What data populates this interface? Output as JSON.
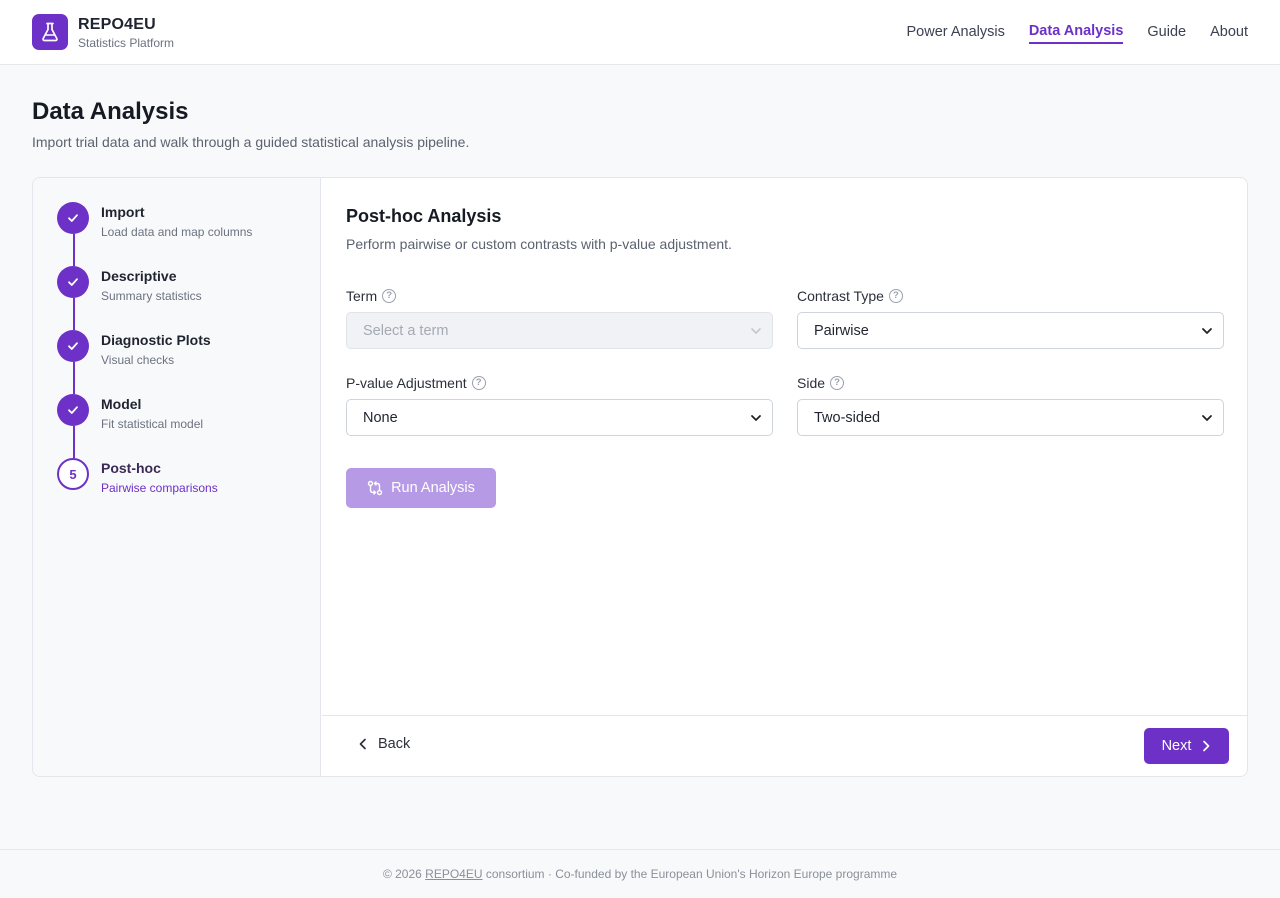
{
  "brand": {
    "name": "REPO4EU",
    "subtitle": "Statistics Platform"
  },
  "nav": [
    {
      "label": "Power Analysis",
      "active": false
    },
    {
      "label": "Data Analysis",
      "active": true
    },
    {
      "label": "Guide",
      "active": false
    },
    {
      "label": "About",
      "active": false
    }
  ],
  "page": {
    "title": "Data Analysis",
    "subtitle": "Import trial data and walk through a guided statistical analysis pipeline."
  },
  "steps": [
    {
      "title": "Import",
      "desc": "Load data and map columns",
      "state": "done"
    },
    {
      "title": "Descriptive",
      "desc": "Summary statistics",
      "state": "done"
    },
    {
      "title": "Diagnostic Plots",
      "desc": "Visual checks",
      "state": "done"
    },
    {
      "title": "Model",
      "desc": "Fit statistical model",
      "state": "done"
    },
    {
      "title": "Post-hoc",
      "desc": "Pairwise comparisons",
      "state": "current",
      "number": "5"
    }
  ],
  "panel": {
    "title": "Post-hoc Analysis",
    "subtitle": "Perform pairwise or custom contrasts with p-value adjustment.",
    "fields": {
      "term": {
        "label": "Term",
        "placeholder": "Select a term",
        "disabled": true
      },
      "contrast_type": {
        "label": "Contrast Type",
        "value": "Pairwise"
      },
      "p_adjust": {
        "label": "P-value Adjustment",
        "value": "None"
      },
      "side": {
        "label": "Side",
        "value": "Two-sided"
      }
    },
    "run_button": "Run Analysis",
    "back_button": "Back",
    "next_button": "Next"
  },
  "footer": {
    "prefix": "© 2026 ",
    "link": "REPO4EU",
    "suffix": " consortium · Co-funded by the European Union's Horizon Europe programme"
  },
  "colors": {
    "accent": "#6d31c8",
    "accent_disabled": "#b79ae6"
  }
}
